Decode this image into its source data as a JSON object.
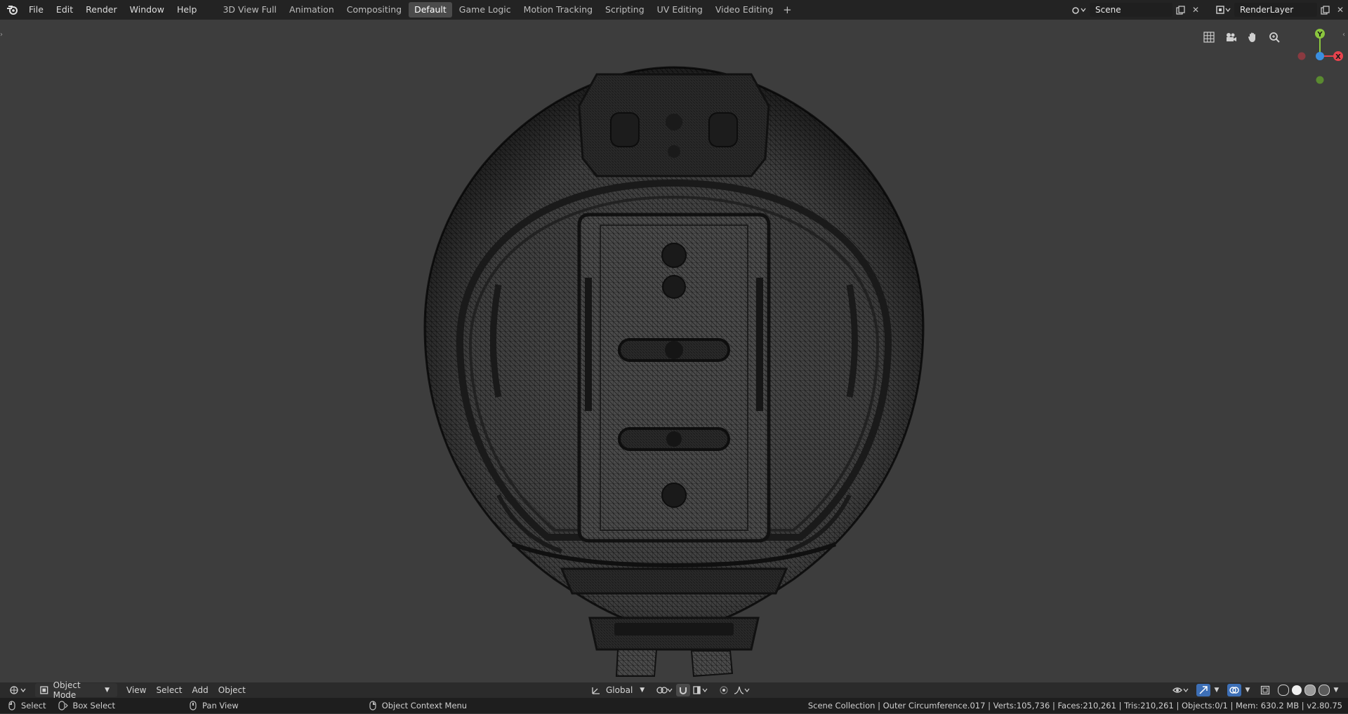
{
  "topbar": {
    "menu": [
      "File",
      "Edit",
      "Render",
      "Window",
      "Help"
    ],
    "tabs": [
      "3D View Full",
      "Animation",
      "Compositing",
      "Default",
      "Game Logic",
      "Motion Tracking",
      "Scripting",
      "UV Editing",
      "Video Editing"
    ],
    "active_tab": "Default",
    "add_tab": "+",
    "scene_value": "Scene",
    "render_layer_value": "RenderLayer"
  },
  "viewport": {
    "gizmo": {
      "y": "Y",
      "x": "X"
    }
  },
  "header3d": {
    "mode": "Object Mode",
    "view": "View",
    "select": "Select",
    "add": "Add",
    "object": "Object",
    "orientation": "Global"
  },
  "statusbar": {
    "select": "Select",
    "box_select": "Box Select",
    "pan_view": "Pan View",
    "context_menu": "Object Context Menu",
    "stats": "Scene Collection | Outer Circumference.017 | Verts:105,736 | Faces:210,261 | Tris:210,261 | Objects:0/1 | Mem: 630.2 MB | v2.80.75"
  },
  "colors": {
    "axis_y": "#8bc63e",
    "axis_x": "#e8434d",
    "axis_z": "#3b8fe0",
    "viewport_bg": "#3d3d3d"
  }
}
